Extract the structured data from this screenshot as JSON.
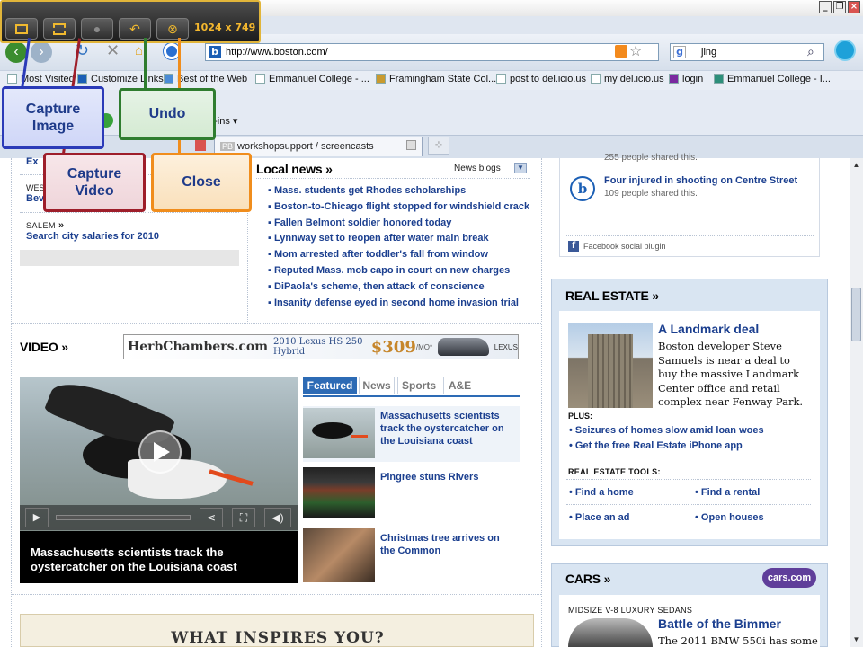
{
  "jing": {
    "size_label": "1024 x 749",
    "buttons": [
      {
        "icon": "capture-image-icon"
      },
      {
        "icon": "capture-video-icon"
      },
      {
        "icon": "share-icon"
      },
      {
        "icon": "undo-icon"
      },
      {
        "icon": "close-icon"
      }
    ],
    "callouts": {
      "capture_image": "Capture Image",
      "capture_video": "Capture Video",
      "undo": "Undo",
      "close": "Close"
    },
    "colors": {
      "capture_image": "#2b3bb8",
      "capture_video": "#9e1e2a",
      "undo": "#2f7d2f",
      "close": "#f08d1c"
    }
  },
  "browser": {
    "url": "http://www.boston.com/",
    "search_value": "jing",
    "favorites": [
      "Most Visited",
      "Customize Links",
      "Best of the Web",
      "Emmanuel College - ...",
      "Framingham State Col...",
      "post to del.icio.us",
      "my del.icio.us",
      "login",
      "Emmanuel College - I..."
    ],
    "cmd_partial": "g-ins",
    "tab_title": "workshopsupport / screencasts",
    "tab_prefix": "PB"
  },
  "page": {
    "left": {
      "ex_prefix": "Ex",
      "wes_prefix": "WES",
      "bev_prefix": "Bev",
      "salem_label": "SALEM",
      "salem_link": "Search city salaries for 2010"
    },
    "local_news": {
      "title": "Local news",
      "blogs_label": "News blogs",
      "items": [
        "Mass. students get Rhodes scholarships",
        "Boston-to-Chicago flight stopped for windshield crack",
        "Fallen Belmont soldier honored today",
        "Lynnway set to reopen after water main break",
        "Mom arrested after toddler's fall from window",
        "Reputed Mass. mob capo in court on new charges",
        "DiPaola's scheme, then attack of conscience",
        "Insanity defense eyed in second home invasion trial"
      ]
    },
    "social": {
      "shared_partial": "255 people shared this.",
      "story": "Four injured in shooting on Centre Street",
      "shared": "109 people shared this.",
      "plugin": "Facebook social plugin"
    },
    "video": {
      "title": "VIDEO",
      "ad_brand": "HerbChambers.com",
      "ad_model": "2010 Lexus HS 250 Hybrid",
      "ad_price": "$309",
      "ad_per": "/MO*",
      "ad_logo": "LEXUS",
      "tabs": [
        "Featured",
        "News",
        "Sports",
        "A&E"
      ],
      "caption": "Massachusetts scientists track the oystercatcher on the Louisiana coast",
      "items": [
        "Massachusetts scientists track the oystercatcher on the Louisiana coast",
        "Pingree stuns Rivers",
        "Christmas tree arrives on the Common"
      ]
    },
    "real_estate": {
      "title": "REAL ESTATE",
      "headline": "A Landmark deal",
      "blurb": "Boston developer Steve Samuels is near a deal to buy the massive Landmark Center office and retail complex near Fenway Park.",
      "plus_label": "PLUS:",
      "plus_items": [
        "Seizures of homes slow amid loan woes",
        "Get the free Real Estate iPhone app"
      ],
      "tools_label": "REAL ESTATE TOOLS:",
      "tools": [
        "Find a home",
        "Find a rental",
        "Place an ad",
        "Open houses"
      ]
    },
    "cars": {
      "title": "CARS",
      "badge": "cars.com",
      "sub": "MIDSIZE V-8 LUXURY SEDANS",
      "headline": "Battle of the Bimmer",
      "blurb_partial": "The 2011 BMW 550i has some"
    },
    "inspire": "WHAT INSPIRES YOU?"
  }
}
